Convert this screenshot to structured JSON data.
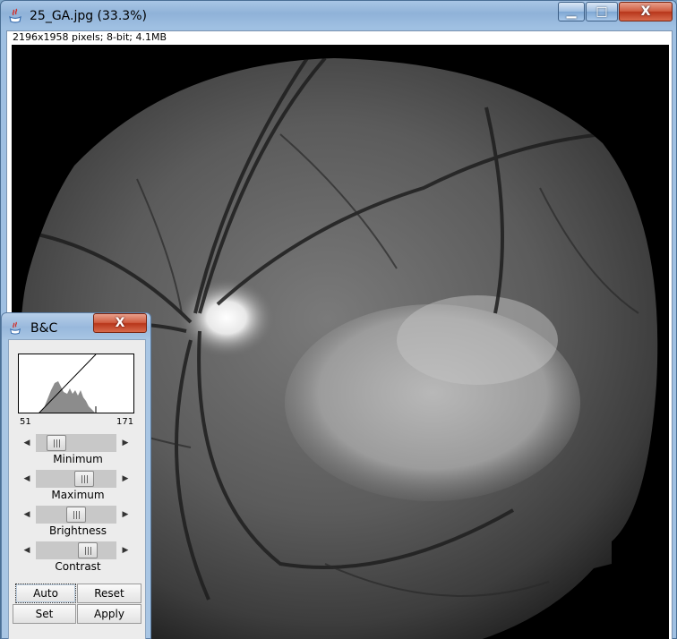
{
  "window": {
    "title": "25_GA.jpg (33.3%)",
    "info": "2196x1958 pixels; 8-bit; 4.1MB",
    "controls": {
      "minimize": "▁",
      "maximize": "□",
      "close": "X"
    }
  },
  "image": {
    "description_icon": "java-icon"
  },
  "bc_panel": {
    "title": "B&C",
    "close": "X",
    "histogram": {
      "min_label": "51",
      "max_label": "171"
    },
    "sliders": [
      {
        "label": "Minimum",
        "value": 0.17
      },
      {
        "label": "Maximum",
        "value": 0.63
      },
      {
        "label": "Brightness",
        "value": 0.5
      },
      {
        "label": "Contrast",
        "value": 0.69
      }
    ],
    "buttons": {
      "auto": "Auto",
      "reset": "Reset",
      "set": "Set",
      "apply": "Apply"
    }
  },
  "colors": {
    "titlebar": "#9fc0e2",
    "close": "#c8432a",
    "panel_bg": "#ececec"
  }
}
